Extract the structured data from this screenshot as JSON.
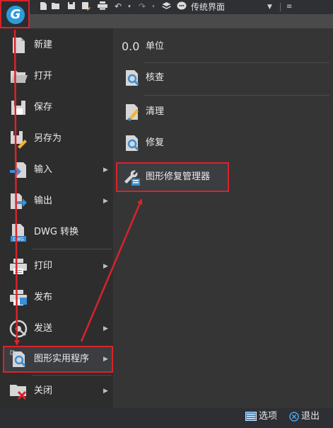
{
  "toolbar": {
    "workspace_label": "传统界面",
    "icons": [
      "new-icon",
      "open-icon",
      "save-icon",
      "save-as-icon",
      "print-icon",
      "undo-icon",
      "redo-icon",
      "layers-icon",
      "chat-icon"
    ]
  },
  "menu": {
    "items": [
      {
        "label": "新建",
        "has_submenu": false
      },
      {
        "label": "打开",
        "has_submenu": false
      },
      {
        "label": "保存",
        "has_submenu": false
      },
      {
        "label": "另存为",
        "has_submenu": false
      },
      {
        "label": "输入",
        "has_submenu": true
      },
      {
        "label": "输出",
        "has_submenu": true
      },
      {
        "label": "DWG 转换",
        "has_submenu": false
      },
      {
        "label": "打印",
        "has_submenu": true
      },
      {
        "label": "发布",
        "has_submenu": false
      },
      {
        "label": "发送",
        "has_submenu": true
      },
      {
        "label": "图形实用程序",
        "has_submenu": true
      },
      {
        "label": "关闭",
        "has_submenu": true
      }
    ],
    "submenu_items": [
      {
        "label": "单位",
        "icon_text": "0.0"
      },
      {
        "label": "核查"
      },
      {
        "label": "清理"
      },
      {
        "label": "修复"
      },
      {
        "label": "图形修复管理器"
      }
    ],
    "selected_item": "图形实用程序",
    "highlighted_subitem": "图形修复管理器"
  },
  "bottom": {
    "options_label": "选项",
    "exit_label": "退出"
  },
  "colors": {
    "annotation_red": "#d9232a",
    "logo_blue": "#2d9bd8",
    "icon_blue": "#3a8fd6",
    "icon_yellow": "#f2b233"
  }
}
